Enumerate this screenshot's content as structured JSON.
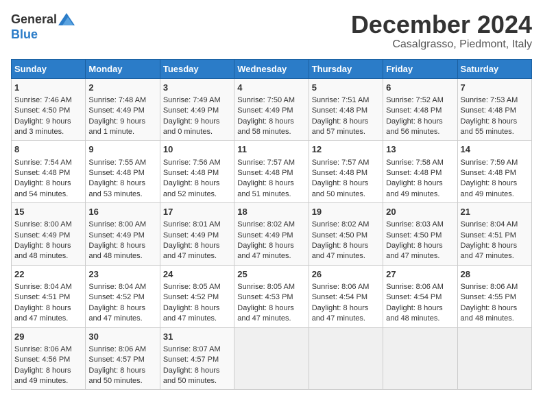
{
  "logo": {
    "general": "General",
    "blue": "Blue"
  },
  "title": "December 2024",
  "subtitle": "Casalgrasso, Piedmont, Italy",
  "days_of_week": [
    "Sunday",
    "Monday",
    "Tuesday",
    "Wednesday",
    "Thursday",
    "Friday",
    "Saturday"
  ],
  "weeks": [
    [
      {
        "day": "1",
        "sunrise": "7:46 AM",
        "sunset": "4:50 PM",
        "daylight": "9 hours and 3 minutes."
      },
      {
        "day": "2",
        "sunrise": "7:48 AM",
        "sunset": "4:49 PM",
        "daylight": "9 hours and 1 minute."
      },
      {
        "day": "3",
        "sunrise": "7:49 AM",
        "sunset": "4:49 PM",
        "daylight": "9 hours and 0 minutes."
      },
      {
        "day": "4",
        "sunrise": "7:50 AM",
        "sunset": "4:49 PM",
        "daylight": "8 hours and 58 minutes."
      },
      {
        "day": "5",
        "sunrise": "7:51 AM",
        "sunset": "4:48 PM",
        "daylight": "8 hours and 57 minutes."
      },
      {
        "day": "6",
        "sunrise": "7:52 AM",
        "sunset": "4:48 PM",
        "daylight": "8 hours and 56 minutes."
      },
      {
        "day": "7",
        "sunrise": "7:53 AM",
        "sunset": "4:48 PM",
        "daylight": "8 hours and 55 minutes."
      }
    ],
    [
      {
        "day": "8",
        "sunrise": "7:54 AM",
        "sunset": "4:48 PM",
        "daylight": "8 hours and 54 minutes."
      },
      {
        "day": "9",
        "sunrise": "7:55 AM",
        "sunset": "4:48 PM",
        "daylight": "8 hours and 53 minutes."
      },
      {
        "day": "10",
        "sunrise": "7:56 AM",
        "sunset": "4:48 PM",
        "daylight": "8 hours and 52 minutes."
      },
      {
        "day": "11",
        "sunrise": "7:57 AM",
        "sunset": "4:48 PM",
        "daylight": "8 hours and 51 minutes."
      },
      {
        "day": "12",
        "sunrise": "7:57 AM",
        "sunset": "4:48 PM",
        "daylight": "8 hours and 50 minutes."
      },
      {
        "day": "13",
        "sunrise": "7:58 AM",
        "sunset": "4:48 PM",
        "daylight": "8 hours and 49 minutes."
      },
      {
        "day": "14",
        "sunrise": "7:59 AM",
        "sunset": "4:48 PM",
        "daylight": "8 hours and 49 minutes."
      }
    ],
    [
      {
        "day": "15",
        "sunrise": "8:00 AM",
        "sunset": "4:49 PM",
        "daylight": "8 hours and 48 minutes."
      },
      {
        "day": "16",
        "sunrise": "8:00 AM",
        "sunset": "4:49 PM",
        "daylight": "8 hours and 48 minutes."
      },
      {
        "day": "17",
        "sunrise": "8:01 AM",
        "sunset": "4:49 PM",
        "daylight": "8 hours and 47 minutes."
      },
      {
        "day": "18",
        "sunrise": "8:02 AM",
        "sunset": "4:49 PM",
        "daylight": "8 hours and 47 minutes."
      },
      {
        "day": "19",
        "sunrise": "8:02 AM",
        "sunset": "4:50 PM",
        "daylight": "8 hours and 47 minutes."
      },
      {
        "day": "20",
        "sunrise": "8:03 AM",
        "sunset": "4:50 PM",
        "daylight": "8 hours and 47 minutes."
      },
      {
        "day": "21",
        "sunrise": "8:04 AM",
        "sunset": "4:51 PM",
        "daylight": "8 hours and 47 minutes."
      }
    ],
    [
      {
        "day": "22",
        "sunrise": "8:04 AM",
        "sunset": "4:51 PM",
        "daylight": "8 hours and 47 minutes."
      },
      {
        "day": "23",
        "sunrise": "8:04 AM",
        "sunset": "4:52 PM",
        "daylight": "8 hours and 47 minutes."
      },
      {
        "day": "24",
        "sunrise": "8:05 AM",
        "sunset": "4:52 PM",
        "daylight": "8 hours and 47 minutes."
      },
      {
        "day": "25",
        "sunrise": "8:05 AM",
        "sunset": "4:53 PM",
        "daylight": "8 hours and 47 minutes."
      },
      {
        "day": "26",
        "sunrise": "8:06 AM",
        "sunset": "4:54 PM",
        "daylight": "8 hours and 47 minutes."
      },
      {
        "day": "27",
        "sunrise": "8:06 AM",
        "sunset": "4:54 PM",
        "daylight": "8 hours and 48 minutes."
      },
      {
        "day": "28",
        "sunrise": "8:06 AM",
        "sunset": "4:55 PM",
        "daylight": "8 hours and 48 minutes."
      }
    ],
    [
      {
        "day": "29",
        "sunrise": "8:06 AM",
        "sunset": "4:56 PM",
        "daylight": "8 hours and 49 minutes."
      },
      {
        "day": "30",
        "sunrise": "8:06 AM",
        "sunset": "4:57 PM",
        "daylight": "8 hours and 50 minutes."
      },
      {
        "day": "31",
        "sunrise": "8:07 AM",
        "sunset": "4:57 PM",
        "daylight": "8 hours and 50 minutes."
      },
      null,
      null,
      null,
      null
    ]
  ]
}
